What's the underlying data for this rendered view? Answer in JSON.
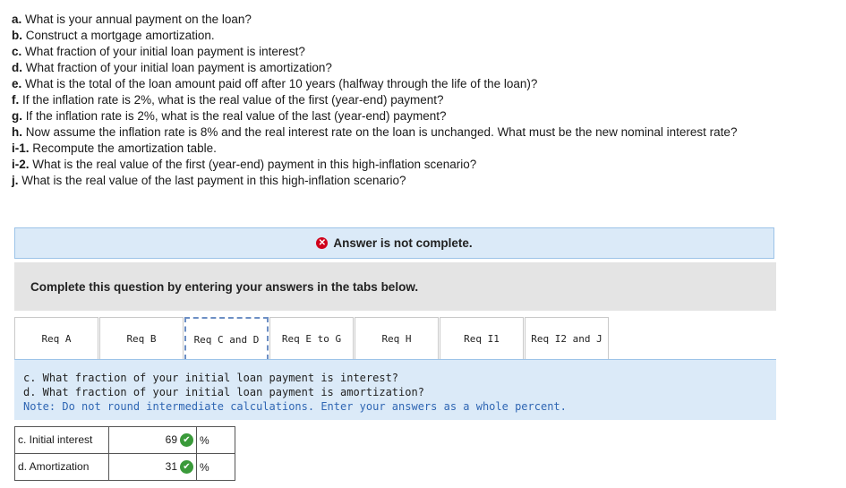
{
  "questions": [
    {
      "label": "a.",
      "text": " What is your annual payment on the loan?"
    },
    {
      "label": "b.",
      "text": " Construct a mortgage amortization."
    },
    {
      "label": "c.",
      "text": " What fraction of your initial loan payment is interest?"
    },
    {
      "label": "d.",
      "text": " What fraction of your initial loan payment is amortization?"
    },
    {
      "label": "e.",
      "text": " What is the total of the loan amount paid off after 10 years (halfway through the life of the loan)?"
    },
    {
      "label": "f.",
      "text": " If the inflation rate is 2%, what is the real value of the first (year-end) payment?"
    },
    {
      "label": "g.",
      "text": " If the inflation rate is 2%, what is the real value of the last (year-end) payment?"
    },
    {
      "label": "h.",
      "text": " Now assume the inflation rate is 8% and the real interest rate on the loan is unchanged. What must be the new nominal interest rate?"
    },
    {
      "label": "i-1.",
      "text": " Recompute the amortization table."
    },
    {
      "label": "i-2.",
      "text": " What is the real value of the first (year-end) payment in this high-inflation scenario?"
    },
    {
      "label": "j.",
      "text": " What is the real value of the last payment in this high-inflation scenario?"
    }
  ],
  "status": {
    "text": "Answer is not complete.",
    "icon": "x-circle-icon",
    "color": "#d0021b"
  },
  "instruction": "Complete this question by entering your answers in the tabs below.",
  "tabs": [
    "Req A",
    "Req B",
    "Req C and D",
    "Req E to G",
    "Req H",
    "Req I1",
    "Req I2 and J"
  ],
  "active_tab": "Req C and D",
  "panel": {
    "line1": "c. What fraction of your initial loan payment is interest?",
    "line2": "d. What fraction of your initial loan payment is amortization?",
    "note": "Note: Do not round intermediate calculations. Enter your answers as a whole percent."
  },
  "answers": [
    {
      "label": "c. Initial interest",
      "value": "69",
      "unit": "%",
      "correct": true
    },
    {
      "label": "d. Amortization",
      "value": "31",
      "unit": "%",
      "correct": true
    }
  ]
}
